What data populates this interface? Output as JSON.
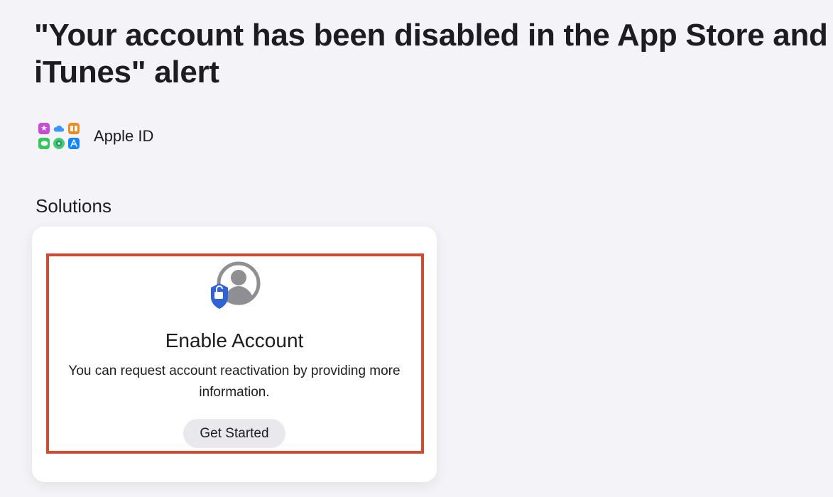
{
  "page": {
    "title": "\"Your account has been disabled in the App Store and iTunes\" alert"
  },
  "product": {
    "name": "Apple ID",
    "icons": [
      "itunes-star-icon",
      "icloud-icon",
      "books-icon",
      "messages-icon",
      "find-my-icon",
      "app-store-icon"
    ]
  },
  "solutions": {
    "heading": "Solutions",
    "card": {
      "icon": "account-lock-icon",
      "title": "Enable Account",
      "description": "You can request account reactivation by providing more information.",
      "button_label": "Get Started"
    }
  },
  "colors": {
    "highlight_border": "#d64830",
    "icon_blue": "#2f63d8",
    "icon_gray": "#8e8e93"
  }
}
